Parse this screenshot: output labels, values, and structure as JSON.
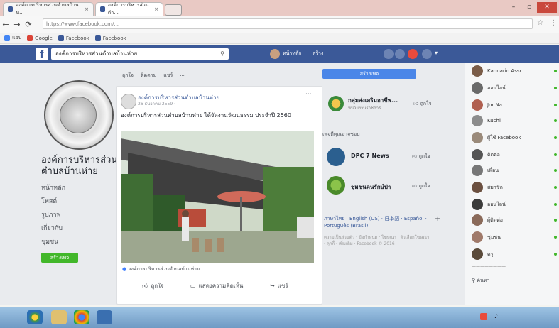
{
  "browser": {
    "tabs": [
      {
        "title": "องค์การบริหารส่วนตำบลบ้านห..."
      },
      {
        "title": "องค์การบริหารส่วนตำ..."
      }
    ],
    "close_glyph": "×",
    "window_buttons": [
      "–",
      "▫",
      "✕"
    ],
    "url": "https://www.facebook.com/...",
    "bookmarks": [
      "แอป",
      "Google",
      "Facebook",
      "Facebook"
    ]
  },
  "facebook": {
    "logo": "f",
    "search_value": "องค์การบริหารส่วนตำบลบ้านห่าย",
    "nav": [
      "หน้าหลัก",
      "สร้าง"
    ]
  },
  "left_column": {
    "page_name_lines": [
      "องค์การบริหารส่วน",
      "ตำบลบ้านห่าย"
    ],
    "nav_items": [
      "หน้าหลัก",
      "โพสต์",
      "รูปภาพ",
      "เกี่ยวกับ",
      "ชุมชน"
    ],
    "button_label": "สร้างเพจ"
  },
  "center": {
    "top_actions": [
      "ถูกใจ",
      "ติดตาม",
      "แชร์",
      "..."
    ],
    "post": {
      "author": "องค์การบริหารส่วนตำบลบ้านห่าย",
      "meta": "26 ธันวาคม 2559 ·",
      "more": "···",
      "text": "องค์การบริหารส่วนตำบลบ้านห่าย ได้จัดงานวัฒนธรรม ประจำปี 2560",
      "caption": "องค์การบริหารส่วนตำบลบ้านห่าย",
      "actions": [
        "ถูกใจ",
        "แสดงความคิดเห็น",
        "แชร์"
      ]
    }
  },
  "right_column": {
    "blue_button": "สร้างเพจ",
    "suggested_top": {
      "name": "กลุ่มส่งเสริมอาชีพ...",
      "sub": "หน่วยงานราชการ",
      "like": "ถูกใจ"
    },
    "section_heading": "เพจที่คุณอาจชอบ",
    "pages": [
      {
        "name": "DPC 7 News",
        "like": "ถูกใจ"
      },
      {
        "name": "ชุมชนคนรักษ์ป่า",
        "like": "ถูกใจ"
      }
    ],
    "languages": "ภาษาไทย · English (US) · 日本語 · Español · Português (Brasil)",
    "plus": "+",
    "footer": "ความเป็นส่วนตัว · ข้อกำหนด · โฆษณา · ตัวเลือกโฆษณา · คุกกี้ · เพิ่มเติม · Facebook © 2016"
  },
  "chat": {
    "contacts": [
      {
        "name": "Kannarin Assr",
        "color": "#7a5c48"
      },
      {
        "name": "ออนไลน์",
        "color": "#6a6a6a"
      },
      {
        "name": "Jor Na",
        "color": "#b06050"
      },
      {
        "name": "Kuchi",
        "color": "#8c8c8c"
      },
      {
        "name": "ผู้ใช้ Facebook",
        "color": "#9a8a7a"
      },
      {
        "name": "ติดต่อ",
        "color": "#555555"
      },
      {
        "name": "เพื่อน",
        "color": "#777777"
      },
      {
        "name": "สมาชิก",
        "color": "#6b5040"
      },
      {
        "name": "ออนไลน์",
        "color": "#3b3b3b"
      },
      {
        "name": "ผู้ติดต่อ",
        "color": "#8a6a5a"
      },
      {
        "name": "ชุมชน",
        "color": "#a07a6a"
      },
      {
        "name": "ครู",
        "color": "#5a4a3a"
      }
    ],
    "footer_label": "ค้นหา"
  },
  "colors": {
    "facebook_blue": "#3b5998",
    "online_green": "#42b72a"
  }
}
